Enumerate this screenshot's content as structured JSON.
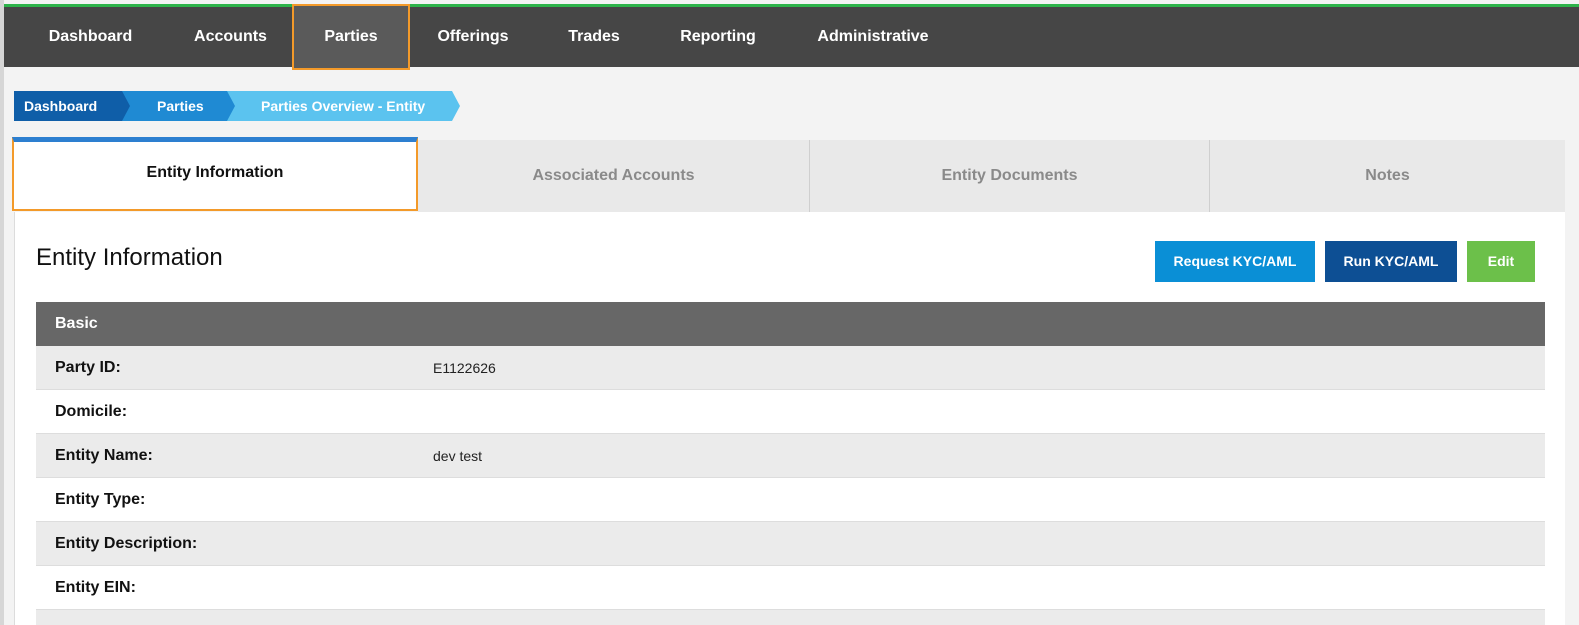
{
  "colors": {
    "nav_bg": "#464646",
    "nav_accent": "#2db34a",
    "highlight_outline": "#f39a2a",
    "crumb_1": "#0f5ea8",
    "crumb_2": "#1f8ad3",
    "crumb_3": "#5bc3ef",
    "btn_request": "#0a8fd6",
    "btn_run": "#0d4f94",
    "btn_edit": "#6cc04a"
  },
  "nav": {
    "items": [
      "Dashboard",
      "Accounts",
      "Parties",
      "Offerings",
      "Trades",
      "Reporting",
      "Administrative"
    ],
    "active": "Parties"
  },
  "breadcrumb": [
    "Dashboard",
    "Parties",
    "Parties Overview - Entity"
  ],
  "tabs": [
    "Entity Information",
    "Associated Accounts",
    "Entity Documents",
    "Notes"
  ],
  "active_tab": "Entity Information",
  "panel": {
    "title": "Entity Information",
    "buttons": {
      "request": "Request KYC/AML",
      "run": "Run KYC/AML",
      "edit": "Edit"
    },
    "section": "Basic",
    "rows": [
      {
        "label": "Party ID:",
        "value": "E1122626"
      },
      {
        "label": "Domicile:",
        "value": ""
      },
      {
        "label": "Entity Name:",
        "value": "dev test"
      },
      {
        "label": "Entity Type:",
        "value": ""
      },
      {
        "label": "Entity Description:",
        "value": ""
      },
      {
        "label": "Entity EIN:",
        "value": ""
      }
    ]
  }
}
